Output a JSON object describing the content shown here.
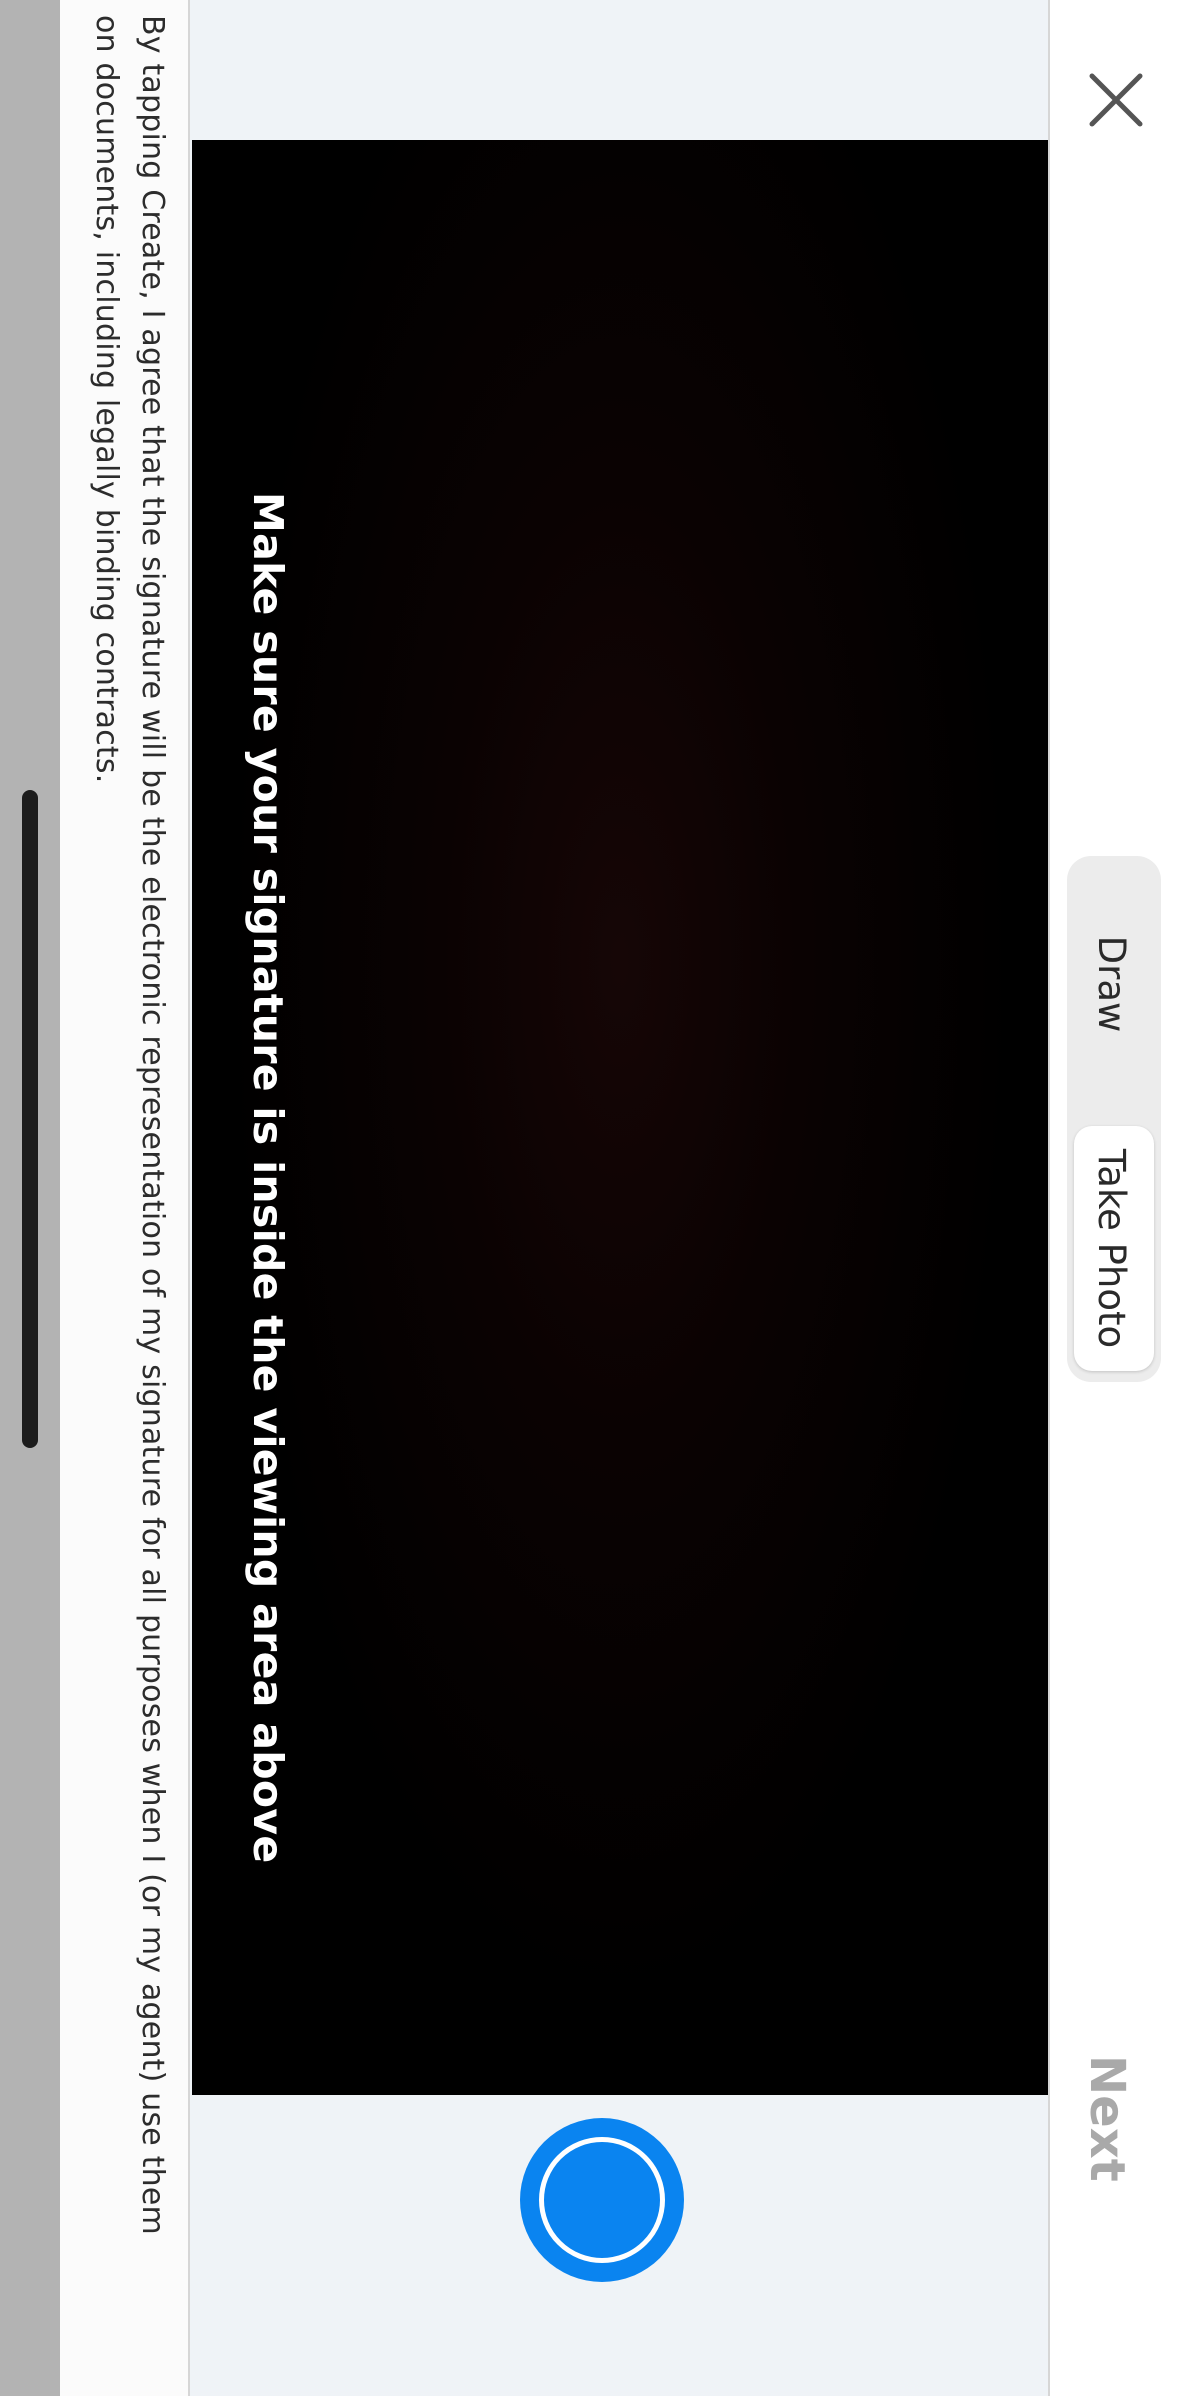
{
  "header": {
    "close_icon": "close-icon",
    "tabs": [
      {
        "label": "Draw",
        "selected": false
      },
      {
        "label": "Take Photo",
        "selected": true
      }
    ],
    "next_label": "Next"
  },
  "camera": {
    "hint": "Make sure your signature is inside the viewing area above",
    "shutter_icon": "shutter-icon",
    "shutter_color": "#0a84f0"
  },
  "disclaimer": {
    "text": "By tapping Create, I agree that the signature will be the electronic representation of my signature for all purposes when I (or my agent) use them on documents, including legally binding contracts."
  }
}
